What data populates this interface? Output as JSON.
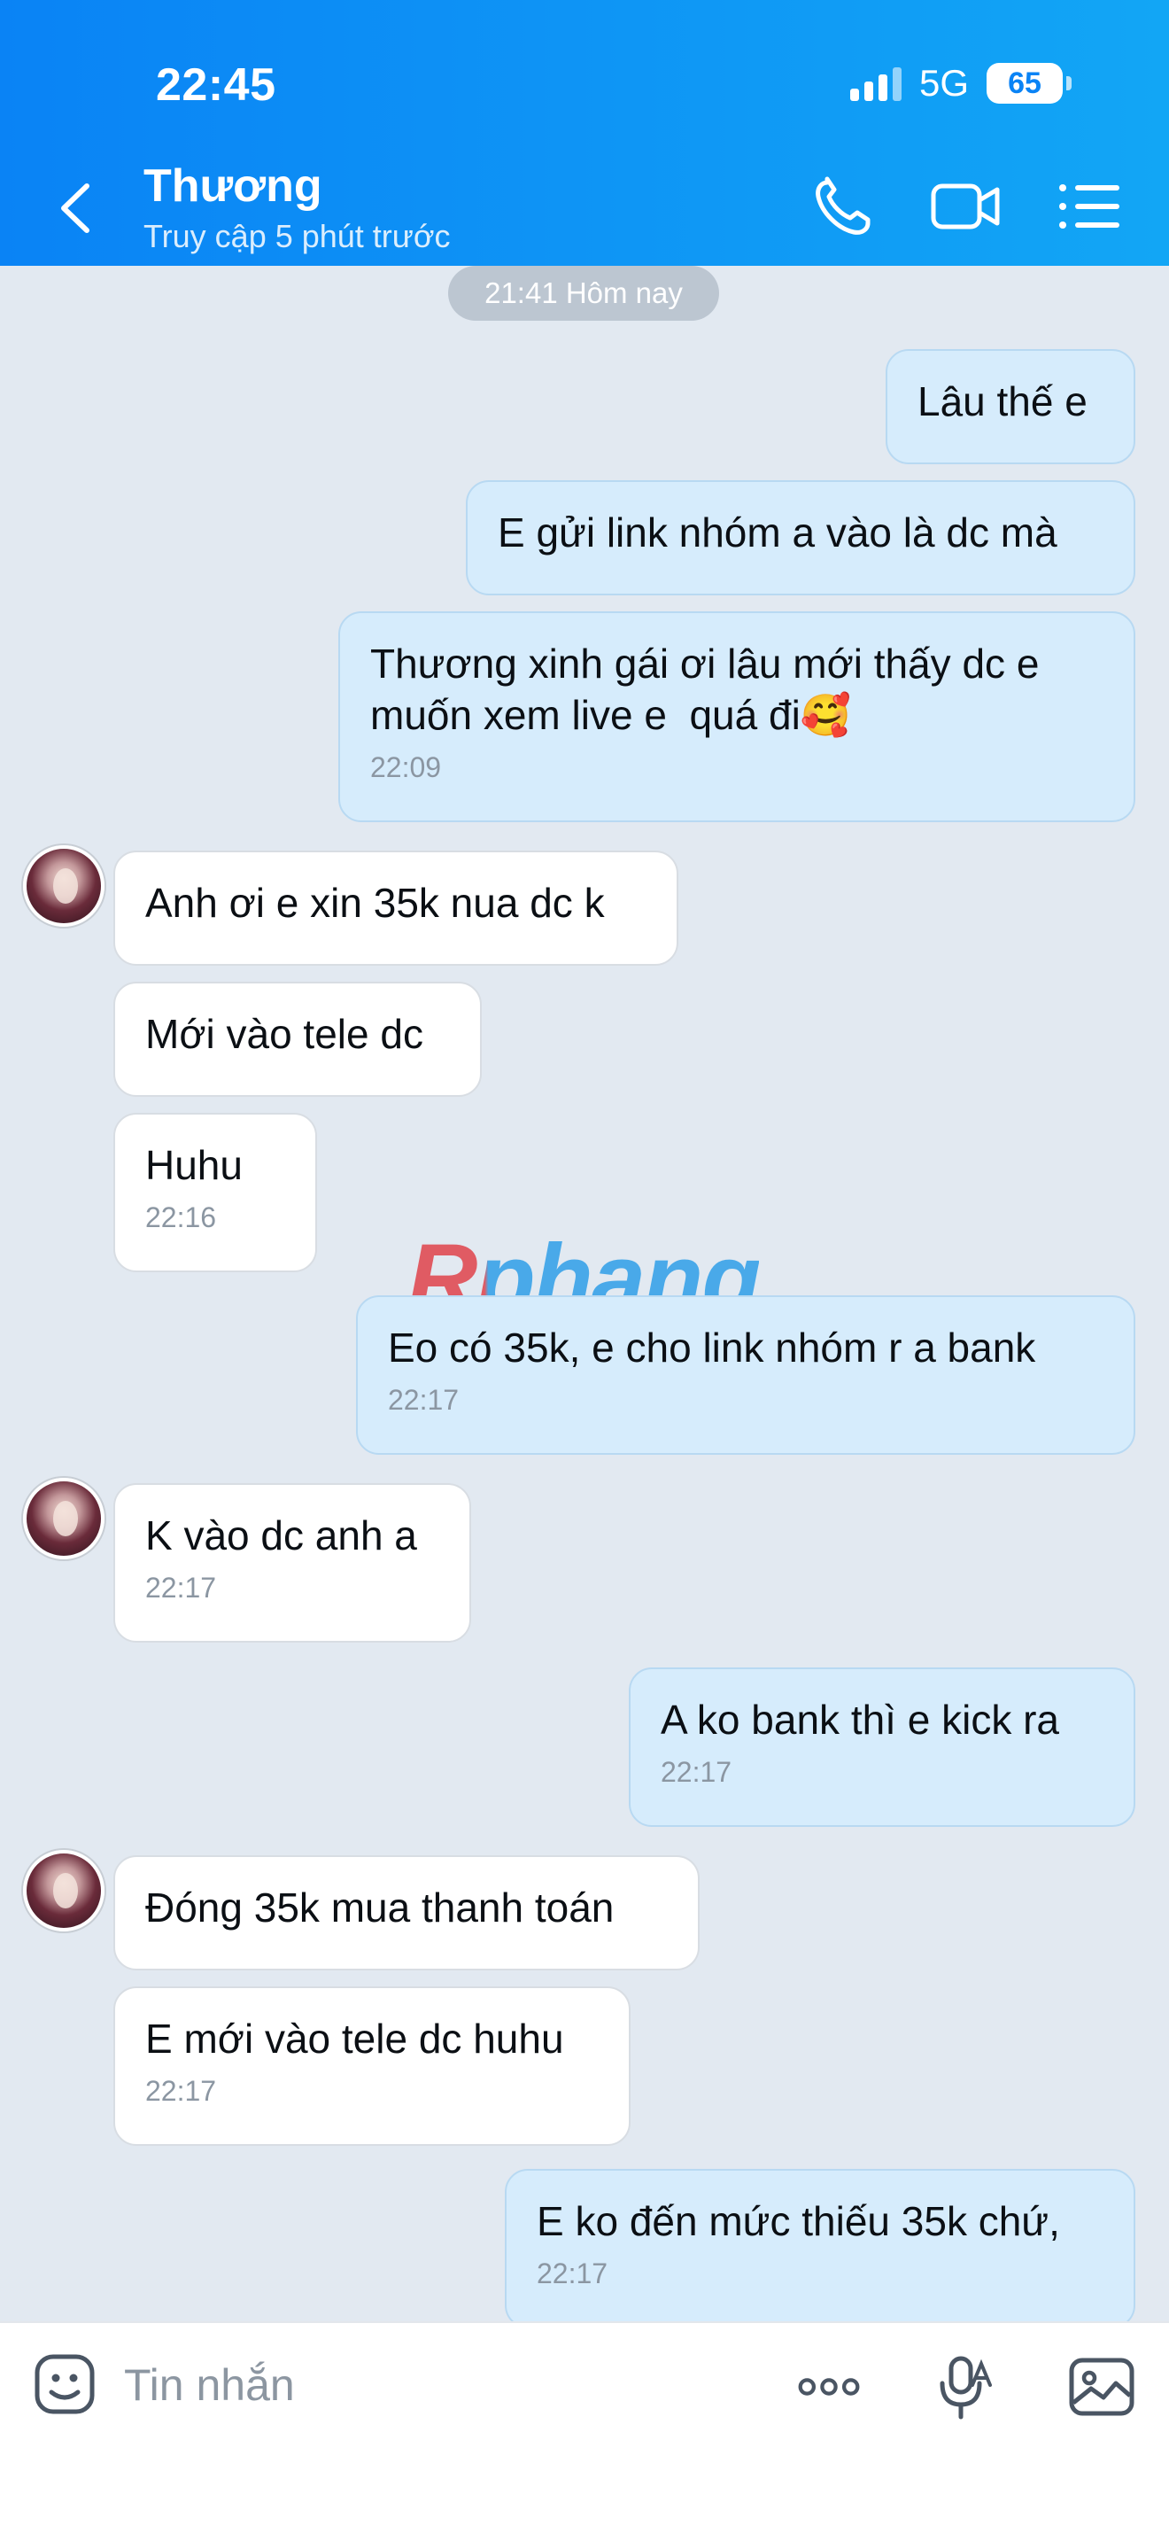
{
  "status_bar": {
    "time": "22:45",
    "network": "5G",
    "battery": "65"
  },
  "header": {
    "contact_name": "Thương",
    "contact_status": "Truy cập 5 phút trước",
    "icons": [
      "back-chevron-icon",
      "phone-icon",
      "video-call-icon",
      "menu-list-icon"
    ]
  },
  "chat": {
    "date_separator": "21:41 Hôm nay",
    "messages": [
      {
        "dir": "out",
        "text": "Lâu thế e",
        "time": ""
      },
      {
        "dir": "out",
        "text": "E gửi link nhóm a vào là dc mà",
        "time": ""
      },
      {
        "dir": "out",
        "text": "Thương xinh gái ơi lâu mới thấy dc e\nmuốn xem live e  quá đi🥰",
        "time": "22:09"
      },
      {
        "dir": "in",
        "text": "Anh ơi e xin 35k nua dc k",
        "time": ""
      },
      {
        "dir": "in",
        "text": "Mới vào tele dc",
        "time": ""
      },
      {
        "dir": "in",
        "text": "Huhu",
        "time": "22:16"
      },
      {
        "dir": "out",
        "text": "Eo có 35k, e cho link nhóm r a bank",
        "time": "22:17"
      },
      {
        "dir": "in",
        "text": "K vào dc anh a",
        "time": "22:17"
      },
      {
        "dir": "out",
        "text": "A ko bank thì e kick ra",
        "time": "22:17"
      },
      {
        "dir": "in",
        "text": "Đóng 35k mua thanh toán",
        "time": ""
      },
      {
        "dir": "in",
        "text": "E mới vào tele dc huhu",
        "time": "22:17"
      },
      {
        "dir": "out",
        "text": "E ko đến mức thiếu 35k chứ,",
        "time": "22:17"
      }
    ],
    "watermark": "Rphang"
  },
  "input_bar": {
    "placeholder": "Tin nhắn",
    "value": ""
  },
  "colors": {
    "header_gradient_start": "#0a83f5",
    "header_gradient_end": "#12a6f5",
    "chat_background": "#e2e9f1",
    "outgoing_bubble": "#d6ecfc",
    "incoming_bubble": "#ffffff"
  }
}
